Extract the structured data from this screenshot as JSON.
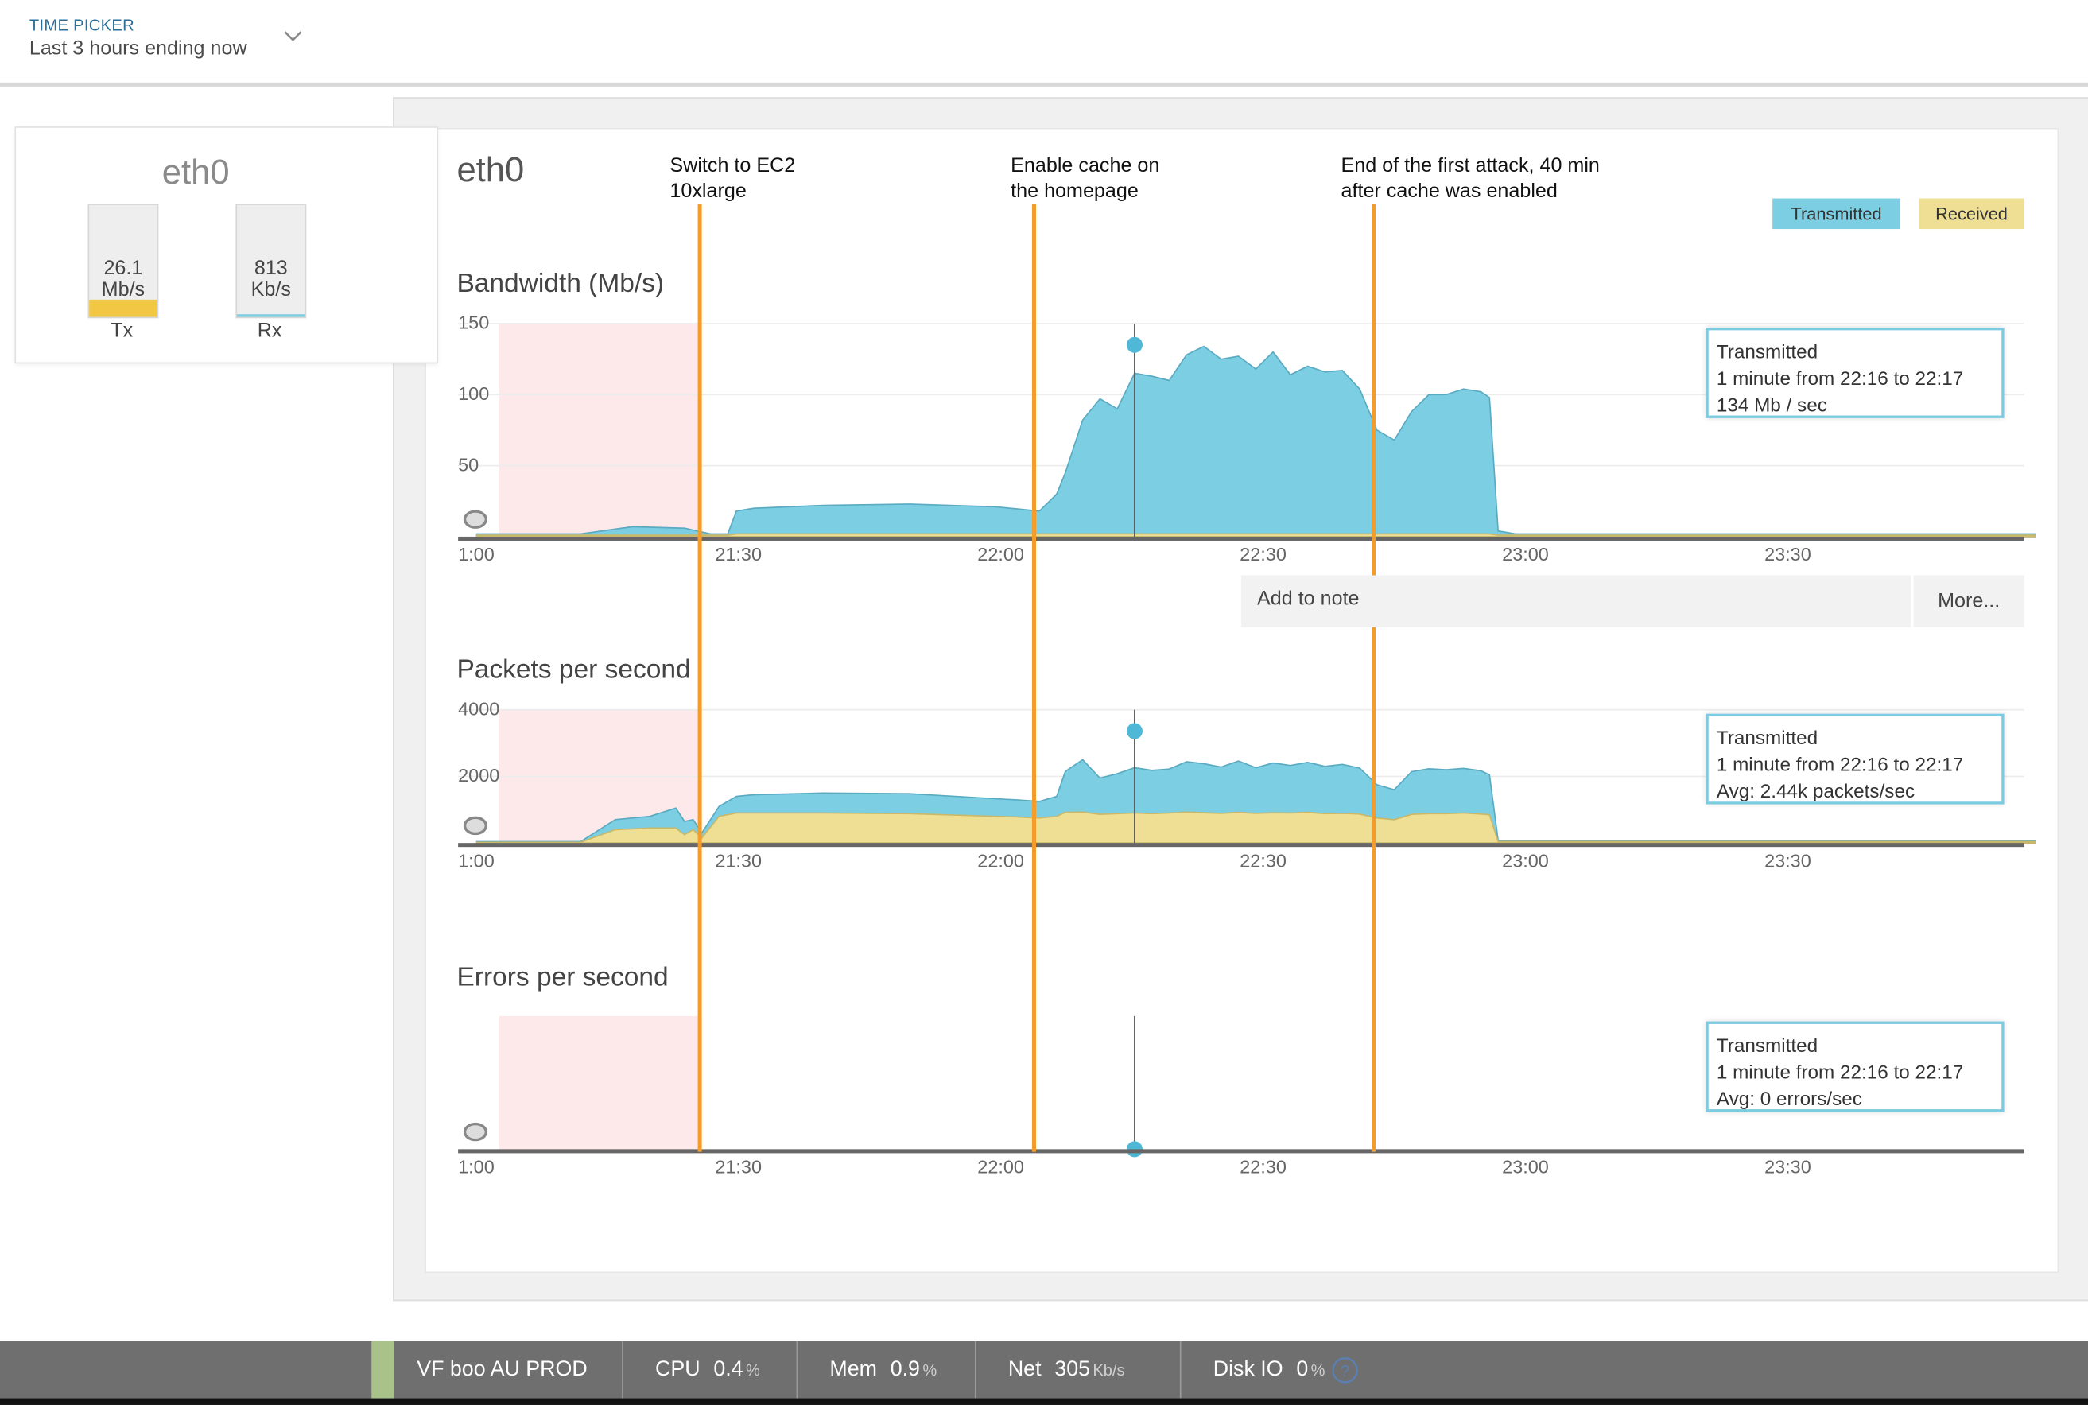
{
  "header": {
    "time_picker_label": "TIME PICKER",
    "time_picker_value": "Last 3 hours ending now"
  },
  "host_card": {
    "title": "eth0",
    "tx": {
      "value": "26.1",
      "unit": "Mb/s",
      "label": "Tx",
      "fill_fraction": 0.15,
      "fill_color": "#f2c744"
    },
    "rx": {
      "value": "813",
      "unit": "Kb/s",
      "label": "Rx",
      "fill_fraction": 0.02,
      "fill_color": "#7ccbe0"
    }
  },
  "panel": {
    "title": "eth0",
    "legend": [
      {
        "label": "Transmitted",
        "color": "#7ccfe2"
      },
      {
        "label": "Received",
        "color": "#efdf94"
      }
    ],
    "annotations": [
      {
        "line1": "Switch to EC2",
        "line2": "10xlarge"
      },
      {
        "line1": "Enable cache on",
        "line2": "the homepage"
      },
      {
        "line1": "End of the first attack, 40 min",
        "line2": "after cache was enabled"
      }
    ]
  },
  "colors": {
    "transmitted": "#7ccfe2",
    "received": "#efdf94",
    "annotation": "#f39c2c",
    "highlight": "#fde8ea"
  },
  "x_ticks": [
    "1:00",
    "21:30",
    "22:00",
    "22:30",
    "23:00",
    "23:30"
  ],
  "charts": {
    "bandwidth": {
      "title": "Bandwidth (Mb/s)",
      "y_ticks": [
        "150",
        "100",
        "50"
      ]
    },
    "packets": {
      "title": "Packets per second",
      "y_ticks": [
        "4000",
        "2000"
      ]
    },
    "errors": {
      "title": "Errors per second"
    }
  },
  "tooltips": {
    "bandwidth": {
      "series": "Transmitted",
      "range": "1 minute from 22:16 to 22:17",
      "value": "134 Mb / sec"
    },
    "packets": {
      "series": "Transmitted",
      "range": "1 minute from 22:16 to 22:17",
      "value": "Avg: 2.44k packets/sec"
    },
    "errors": {
      "series": "Transmitted",
      "range": "1 minute from 22:16 to 22:17",
      "value": "Avg: 0 errors/sec"
    }
  },
  "note": {
    "add_label": "Add to note",
    "more_label": "More..."
  },
  "footer": {
    "host": "VF boo AU PROD",
    "cpu": {
      "label": "CPU",
      "value": "0.4",
      "unit": "%"
    },
    "mem": {
      "label": "Mem",
      "value": "0.9",
      "unit": "%"
    },
    "net": {
      "label": "Net",
      "value": "305",
      "unit": "Kb/s"
    },
    "disk": {
      "label": "Disk IO",
      "value": "0",
      "unit": "%"
    }
  },
  "chart_data": [
    {
      "type": "area",
      "title": "Bandwidth (Mb/s)",
      "ylim": [
        0,
        150
      ],
      "x_minutes": [
        0,
        12,
        18,
        24,
        27,
        29,
        30,
        32,
        40,
        50,
        60,
        65,
        67,
        68,
        70,
        72,
        74,
        76,
        78,
        80,
        82,
        84,
        86,
        88,
        90,
        92,
        94,
        96,
        98,
        100,
        102,
        104,
        106,
        108,
        110,
        112,
        114,
        116,
        117,
        118,
        120,
        130,
        140,
        150,
        160,
        170,
        180
      ],
      "series": [
        {
          "name": "Transmitted",
          "values": [
            2,
            2,
            7,
            6,
            2,
            2,
            18,
            20,
            22,
            23,
            21,
            18,
            30,
            45,
            82,
            97,
            90,
            115,
            113,
            110,
            128,
            134,
            125,
            127,
            118,
            130,
            114,
            120,
            116,
            117,
            104,
            75,
            68,
            88,
            100,
            100,
            104,
            102,
            98,
            4,
            2,
            2,
            2,
            2,
            2,
            2,
            2
          ]
        },
        {
          "name": "Received",
          "values": [
            1,
            1,
            1,
            1,
            1,
            1,
            2,
            2,
            2,
            2,
            2,
            2,
            2,
            2,
            2,
            2,
            2,
            2,
            2,
            2,
            2,
            2,
            2,
            2,
            2,
            2,
            2,
            2,
            2,
            2,
            2,
            2,
            2,
            2,
            2,
            2,
            2,
            2,
            2,
            1,
            1,
            1,
            1,
            1,
            1,
            1,
            1
          ]
        }
      ]
    },
    {
      "type": "area",
      "title": "Packets per second",
      "ylim": [
        0,
        4000
      ],
      "x_minutes": [
        0,
        12,
        16,
        20,
        23,
        24,
        25,
        26,
        28,
        30,
        32,
        40,
        50,
        60,
        62,
        65,
        67,
        68,
        70,
        72,
        74,
        76,
        78,
        80,
        82,
        84,
        86,
        88,
        90,
        92,
        94,
        96,
        98,
        100,
        102,
        104,
        106,
        108,
        110,
        112,
        114,
        116,
        117,
        118,
        120,
        130,
        140,
        150,
        160,
        170,
        180
      ],
      "series": [
        {
          "name": "Transmitted",
          "values": [
            40,
            40,
            700,
            800,
            1050,
            650,
            700,
            300,
            1100,
            1400,
            1450,
            1500,
            1480,
            1330,
            1300,
            1250,
            1400,
            2150,
            2500,
            1950,
            2080,
            2260,
            2180,
            2220,
            2440,
            2380,
            2280,
            2460,
            2260,
            2400,
            2330,
            2420,
            2300,
            2360,
            2250,
            1750,
            1600,
            2140,
            2230,
            2200,
            2240,
            2170,
            2050,
            80,
            80,
            80,
            80,
            80,
            80,
            80,
            80
          ]
        },
        {
          "name": "Received",
          "values": [
            20,
            20,
            400,
            450,
            450,
            250,
            400,
            150,
            800,
            900,
            900,
            900,
            880,
            800,
            790,
            750,
            800,
            920,
            930,
            860,
            880,
            900,
            880,
            900,
            930,
            910,
            890,
            920,
            890,
            910,
            900,
            920,
            880,
            890,
            870,
            750,
            700,
            860,
            880,
            880,
            900,
            870,
            850,
            40,
            40,
            40,
            40,
            40,
            40,
            40,
            40
          ]
        }
      ]
    },
    {
      "type": "area",
      "title": "Errors per second",
      "series": [
        {
          "name": "Transmitted",
          "values": [
            0
          ]
        },
        {
          "name": "Received",
          "values": [
            0
          ]
        }
      ]
    }
  ]
}
